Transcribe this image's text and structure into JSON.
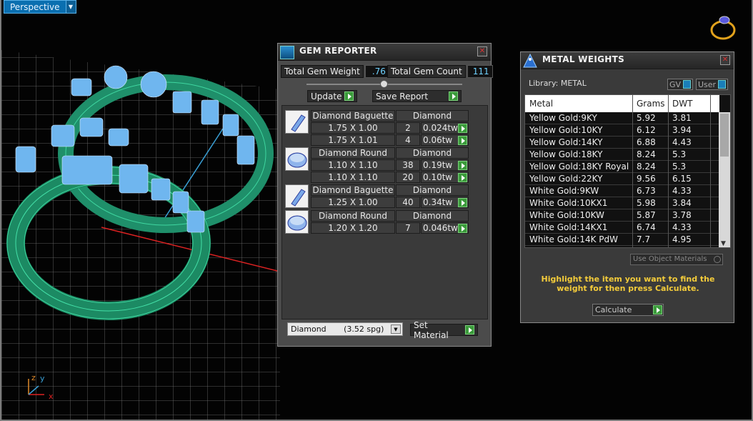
{
  "viewport": {
    "tab_label": "Perspective"
  },
  "gem_reporter": {
    "title": "GEM REPORTER",
    "total_weight_label": "Total Gem Weight",
    "total_weight_value": ".76",
    "total_count_label": "Total Gem Count",
    "total_count_value": "111",
    "update_label": "Update",
    "save_report_label": "Save Report",
    "groups": [
      {
        "shape": "Diamond Baguette",
        "material": "Diamond",
        "rows": [
          {
            "size": "1.75 X 1.00",
            "count": "2",
            "weight": "0.024tw"
          },
          {
            "size": "1.75 X 1.01",
            "count": "4",
            "weight": "0.06tw"
          }
        ]
      },
      {
        "shape": "Diamond Round",
        "material": "Diamond",
        "rows": [
          {
            "size": "1.10 X 1.10",
            "count": "38",
            "weight": "0.19tw"
          },
          {
            "size": "1.10 X 1.10",
            "count": "20",
            "weight": "0.10tw"
          }
        ]
      },
      {
        "shape": "Diamond Baguette",
        "material": "Diamond",
        "rows": [
          {
            "size": "1.25 X 1.00",
            "count": "40",
            "weight": "0.34tw"
          }
        ]
      },
      {
        "shape": "Diamond Round",
        "material": "Diamond",
        "rows": [
          {
            "size": "1.20 X 1.20",
            "count": "7",
            "weight": "0.046tw"
          }
        ]
      }
    ],
    "material_select": "Diamond       (3.52 spg)",
    "set_material_label": "Set Material"
  },
  "metal_weights": {
    "title": "METAL WEIGHTS",
    "library_label": "Library: METAL",
    "gv_label": "GV",
    "user_label": "User",
    "columns": [
      "Metal",
      "Grams",
      "DWT"
    ],
    "rows": [
      [
        "Yellow Gold:9KY",
        "5.92",
        "3.81"
      ],
      [
        "Yellow Gold:10KY",
        "6.12",
        "3.94"
      ],
      [
        "Yellow Gold:14KY",
        "6.88",
        "4.43"
      ],
      [
        "Yellow Gold:18KY",
        "8.24",
        "5.3"
      ],
      [
        "Yellow Gold:18KY Royal",
        "8.24",
        "5.3"
      ],
      [
        "Yellow Gold:22KY",
        "9.56",
        "6.15"
      ],
      [
        "White Gold:9KW",
        "6.73",
        "4.33"
      ],
      [
        "White Gold:10KX1",
        "5.98",
        "3.84"
      ],
      [
        "White Gold:10KW",
        "5.87",
        "3.78"
      ],
      [
        "White Gold:14KX1",
        "6.74",
        "4.33"
      ],
      [
        "White Gold:14K PdW",
        "7.7",
        "4.95"
      ]
    ],
    "use_object_materials": "Use Object Materials",
    "hint": "Highlight the item you want to find the weight for then press Calculate.",
    "calculate_label": "Calculate"
  },
  "axis": {
    "x": "x",
    "y": "y",
    "z": "z"
  }
}
